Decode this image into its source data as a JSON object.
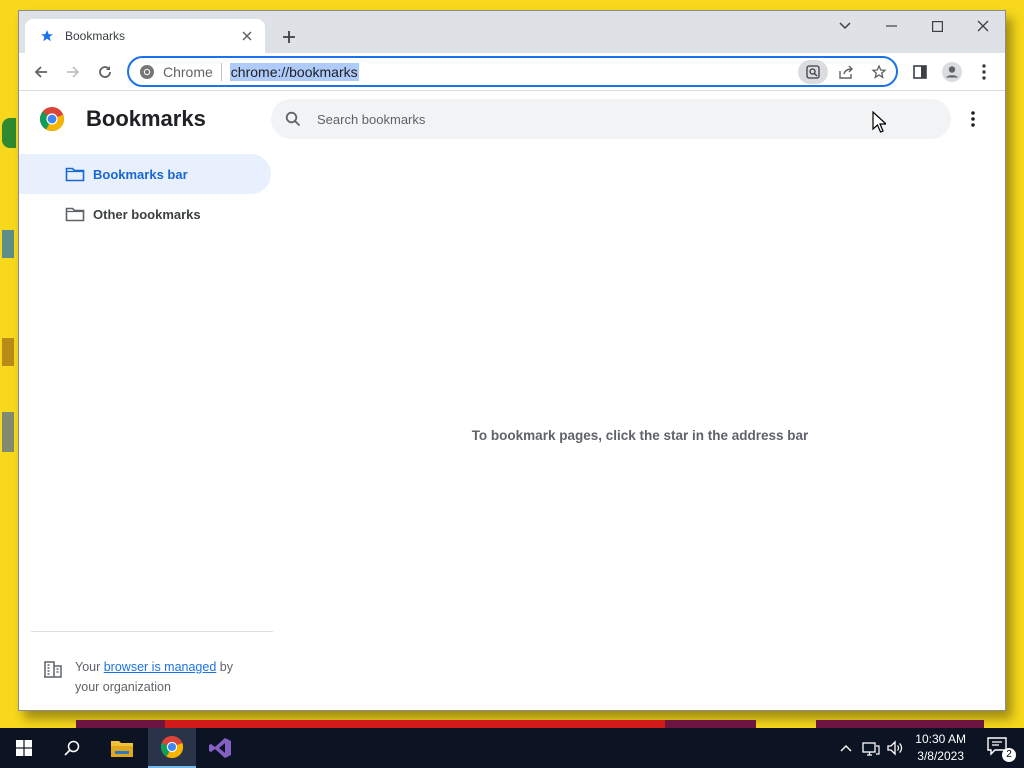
{
  "tab": {
    "title": "Bookmarks",
    "favicon": "star-icon"
  },
  "window_controls": [
    "tab-search-icon",
    "minimize-icon",
    "maximize-icon",
    "close-icon"
  ],
  "omnibox": {
    "site_label": "Chrome",
    "url": "chrome://bookmarks"
  },
  "page": {
    "title": "Bookmarks",
    "search_placeholder": "Search bookmarks",
    "empty_message": "To bookmark pages, click the star in the address bar"
  },
  "sidebar": {
    "items": [
      {
        "label": "Bookmarks bar",
        "active": true
      },
      {
        "label": "Other bookmarks",
        "active": false
      }
    ]
  },
  "managed_notice": {
    "prefix": "Your ",
    "link": "browser is managed",
    "suffix": " by your organization"
  },
  "taskbar": {
    "time": "10:30 AM",
    "date": "3/8/2023",
    "notifications": "2"
  },
  "colors": {
    "accent": "#1a73e8",
    "desktop": "#f7d81c",
    "taskbar": "#0c1424"
  }
}
